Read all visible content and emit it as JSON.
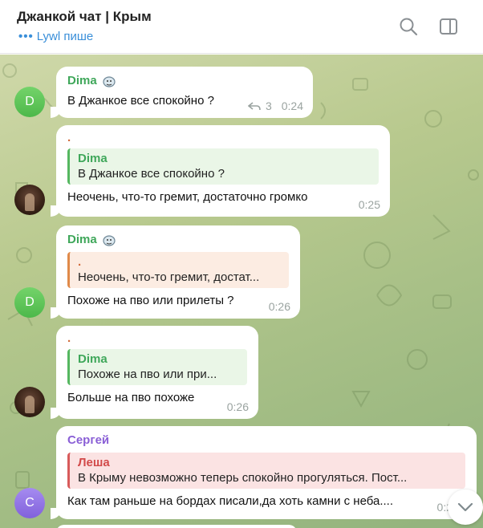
{
  "header": {
    "title": "Джанкой чат | Крым",
    "status_dots": "•••",
    "status": "Lywl пише",
    "search_icon": "search-icon",
    "sidebar_icon": "sidebar-toggle-icon"
  },
  "messages": [
    {
      "sender": "Dima",
      "avatar_letter": "D",
      "text": "В Джанкое все спокойно ?",
      "replies_count": "3",
      "time": "0:24"
    },
    {
      "sender": ".",
      "reply_to_name": "Dima",
      "reply_to_text": "В Джанкое все спокойно ?",
      "text": "Неочень, что-то гремит, достаточно громко",
      "time": "0:25"
    },
    {
      "sender": "Dima",
      "avatar_letter": "D",
      "reply_to_name": ".",
      "reply_to_text": "Неочень, что-то гремит, достат...",
      "text": "Похоже на пво или прилеты ?",
      "time": "0:26"
    },
    {
      "sender": ".",
      "reply_to_name": "Dima",
      "reply_to_text": "Похоже на пво или при...",
      "text": "Больше на пво похоже",
      "time": "0:26"
    },
    {
      "sender": "Сергей",
      "avatar_letter": "C",
      "reply_to_name": "Леша",
      "reply_to_text": "В Крыму невозможно теперь спокойно прогуляться. Пост...",
      "text": "Как там раньше на бордах писали,да хоть камни с неба....",
      "time": "0:2"
    }
  ],
  "colors": {
    "header_bg": "#ffffff",
    "accent_blue": "#3a8fd9",
    "sender_green": "#3fa75a",
    "sender_purple": "#8a5fd6",
    "sender_orange": "#d26b3b",
    "sender_red": "#d24a4a",
    "chat_bg": "#a8c087"
  }
}
